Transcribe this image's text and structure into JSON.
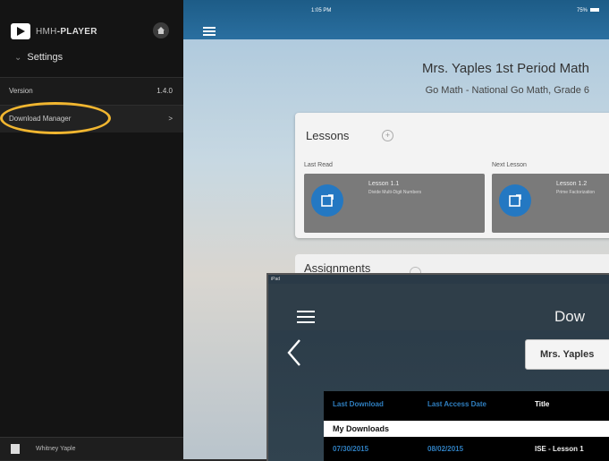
{
  "sidebar": {
    "brand": {
      "prefix": "HMH",
      "suffix": "PLAYER"
    },
    "settings_label": "Settings",
    "rows": [
      {
        "label": "Version",
        "value": "1.4.0"
      },
      {
        "label": "Download Manager",
        "value": ">"
      }
    ],
    "footer_user": "Whitney Yaple"
  },
  "status_bar": {
    "time": "1:05 PM",
    "battery": "75%"
  },
  "main": {
    "class_title": "Mrs. Yaples 1st Period Math",
    "class_subtitle": "Go Math - National Go Math, Grade 6",
    "lessons": {
      "title": "Lessons",
      "last_read_label": "Last Read",
      "next_lesson_label": "Next Lesson",
      "last_read": {
        "title": "Lesson 1.1",
        "subtitle": "Divide Multi-Digit Numbers"
      },
      "next": {
        "title": "Lesson 1.2",
        "subtitle": "Prime Factorization"
      }
    },
    "assignments_title": "Assignments"
  },
  "overlay": {
    "status": "iPad",
    "title": "Dow",
    "class_button": "Mrs. Yaples",
    "columns": [
      "Last Download",
      "Last Access Date",
      "Title"
    ],
    "section": "My Downloads",
    "row": {
      "last_download": "07/30/2015",
      "last_access": "08/02/2015",
      "title": "ISE - Lesson 1"
    }
  }
}
